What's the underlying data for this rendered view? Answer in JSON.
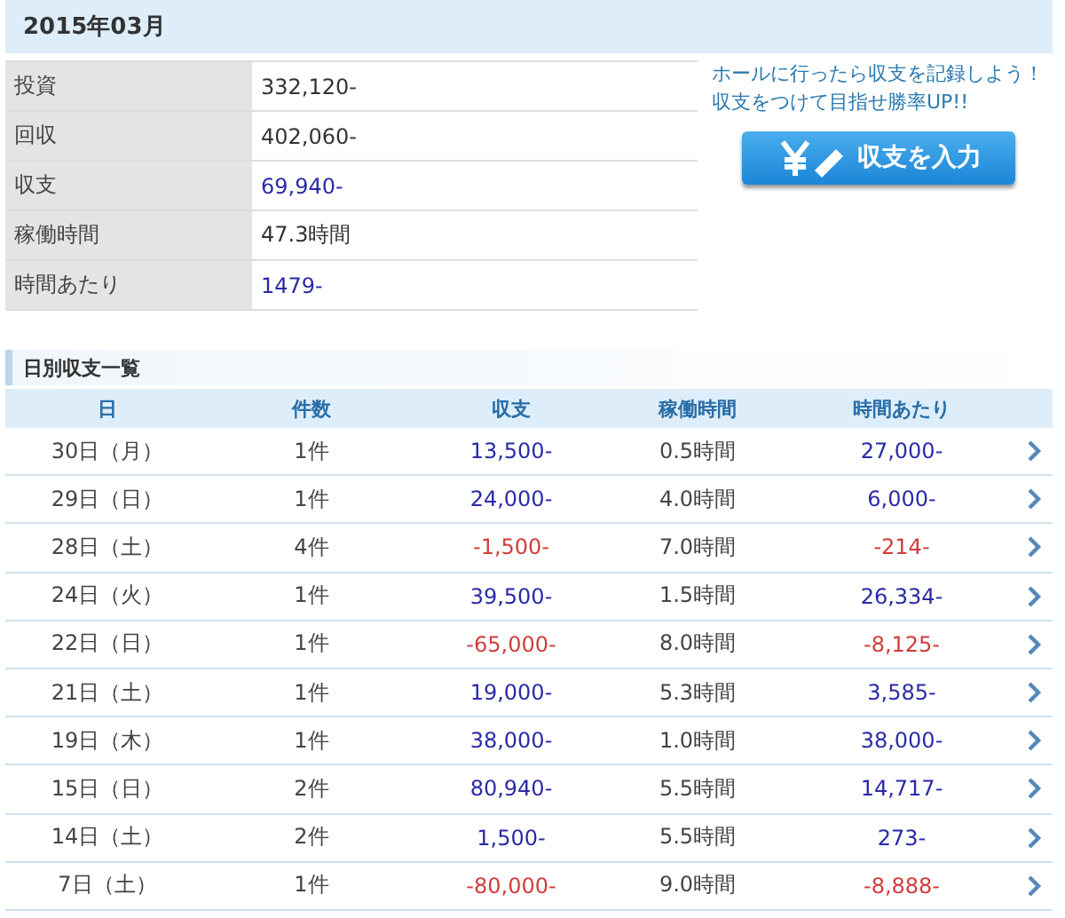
{
  "header": {
    "title": "2015年03月"
  },
  "summary": [
    {
      "label": "投資",
      "value": "332,120-",
      "color": "#333333"
    },
    {
      "label": "回収",
      "value": "402,060-",
      "color": "#333333"
    },
    {
      "label": "収支",
      "value": "69,940-",
      "color": "#2a2aa8"
    },
    {
      "label": "稼働時間",
      "value": "47.3時間",
      "color": "#333333"
    },
    {
      "label": "時間あたり",
      "value": "1479-",
      "color": "#2a2aa8"
    }
  ],
  "promo": {
    "text": "ホールに行ったら収支を記録しよう！収支をつけて目指せ勝率UP!!",
    "button": "収支を入力"
  },
  "daily": {
    "title": "日別収支一覧",
    "columns": [
      "日",
      "件数",
      "収支",
      "稼働時間",
      "時間あたり"
    ],
    "rows": [
      {
        "day": "30日（月）",
        "count": "1件",
        "balance": {
          "text": "13,500-",
          "color": "#2a2aa8"
        },
        "hours": "0.5時間",
        "per_hour": {
          "text": "27,000-",
          "color": "#2a2aa8"
        }
      },
      {
        "day": "29日（日）",
        "count": "1件",
        "balance": {
          "text": "24,000-",
          "color": "#2a2aa8"
        },
        "hours": "4.0時間",
        "per_hour": {
          "text": "6,000-",
          "color": "#2a2aa8"
        }
      },
      {
        "day": "28日（土）",
        "count": "4件",
        "balance": {
          "text": "-1,500-",
          "color": "#d23c3c"
        },
        "hours": "7.0時間",
        "per_hour": {
          "text": "-214-",
          "color": "#d23c3c"
        }
      },
      {
        "day": "24日（火）",
        "count": "1件",
        "balance": {
          "text": "39,500-",
          "color": "#2a2aa8"
        },
        "hours": "1.5時間",
        "per_hour": {
          "text": "26,334-",
          "color": "#2a2aa8"
        }
      },
      {
        "day": "22日（日）",
        "count": "1件",
        "balance": {
          "text": "-65,000-",
          "color": "#d23c3c"
        },
        "hours": "8.0時間",
        "per_hour": {
          "text": "-8,125-",
          "color": "#d23c3c"
        }
      },
      {
        "day": "21日（土）",
        "count": "1件",
        "balance": {
          "text": "19,000-",
          "color": "#2a2aa8"
        },
        "hours": "5.3時間",
        "per_hour": {
          "text": "3,585-",
          "color": "#2a2aa8"
        }
      },
      {
        "day": "19日（木）",
        "count": "1件",
        "balance": {
          "text": "38,000-",
          "color": "#2a2aa8"
        },
        "hours": "1.0時間",
        "per_hour": {
          "text": "38,000-",
          "color": "#2a2aa8"
        }
      },
      {
        "day": "15日（日）",
        "count": "2件",
        "balance": {
          "text": "80,940-",
          "color": "#2a2aa8"
        },
        "hours": "5.5時間",
        "per_hour": {
          "text": "14,717-",
          "color": "#2a2aa8"
        }
      },
      {
        "day": "14日（土）",
        "count": "2件",
        "balance": {
          "text": "1,500-",
          "color": "#2a2aa8"
        },
        "hours": "5.5時間",
        "per_hour": {
          "text": "273-",
          "color": "#2a2aa8"
        }
      },
      {
        "day": "7日（土）",
        "count": "1件",
        "balance": {
          "text": "-80,000-",
          "color": "#d23c3c"
        },
        "hours": "9.0時間",
        "per_hour": {
          "text": "-8,888-",
          "color": "#d23c3c"
        }
      }
    ]
  }
}
